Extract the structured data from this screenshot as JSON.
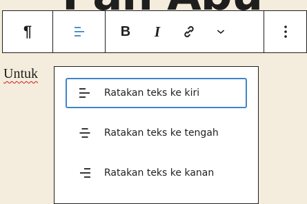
{
  "background": {
    "heading_text": "Pan Abu...",
    "color": "#f4ecdc"
  },
  "toolbar": {
    "paragraph_icon": "¶",
    "bold_label": "B",
    "italic_label": "I",
    "active_color": "#3c85c8"
  },
  "paragraph": {
    "text": "Untuk"
  },
  "dropdown": {
    "items": [
      {
        "label": "Ratakan teks ke kiri",
        "icon": "align-left-icon",
        "active": true
      },
      {
        "label": "Ratakan teks ke tengah",
        "icon": "align-center-icon",
        "active": false
      },
      {
        "label": "Ratakan teks ke kanan",
        "icon": "align-right-icon",
        "active": false
      }
    ]
  }
}
